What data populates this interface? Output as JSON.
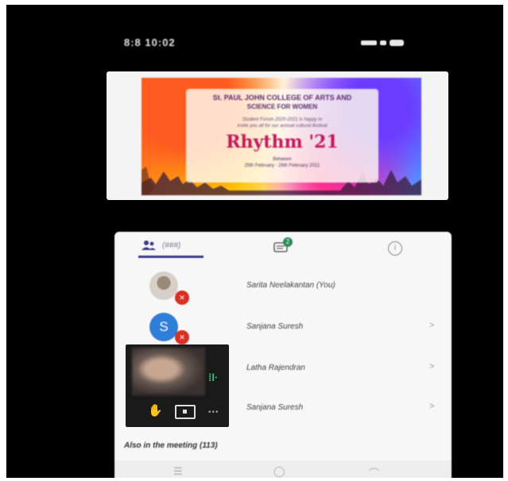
{
  "status_bar": {
    "time": "8:8 10:02"
  },
  "shared_poster": {
    "college_line1": "St. PAUL JOHN COLLEGE OF ARTS AND",
    "college_line2": "SCIENCE FOR WOMEN",
    "invite_line1": "Student Forum 2020-2021 is happy to",
    "invite_line2": "invite you all for our annual cultural festival",
    "title": "Rhythm '21",
    "date_label": "Between",
    "dates": "25th February - 26th February 2021"
  },
  "panel": {
    "tabs": {
      "people_label": "(###)",
      "chat_badge": "2",
      "info_glyph": "i"
    },
    "participants": [
      {
        "name": "Sarita Neelakantan (You)",
        "avatar_type": "photo",
        "muted": true
      },
      {
        "name": "Sanjana Suresh",
        "avatar_type": "initial",
        "initial": "S",
        "muted": true
      },
      {
        "name": "Latha Rajendran",
        "avatar_type": "none",
        "muted": false
      },
      {
        "name": "Sanjana Suresh",
        "avatar_type": "none",
        "muted": false
      }
    ],
    "also_in_meeting": "Also in the meeting (113)"
  },
  "colors": {
    "accent": "#3b3b8a",
    "avatar_blue": "#2f7ed8",
    "mute_red": "#d93025",
    "chat_green": "#2e8b57",
    "title_pink": "#c2185b"
  }
}
